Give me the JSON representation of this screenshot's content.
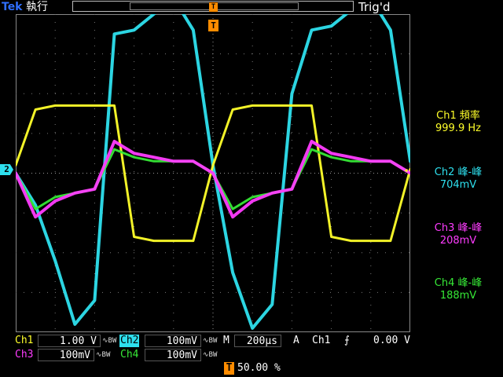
{
  "header": {
    "brand": "Tek",
    "acq_state": "執行",
    "trigger_status": "Trig'd"
  },
  "markers": {
    "ground_ch": "2",
    "trigger_pos_icon": "T",
    "trigger_level_icon": "◂"
  },
  "colors": {
    "ch1": "#ffff2a",
    "ch2": "#2ee0ee",
    "ch3": "#ff3cff",
    "ch4": "#36e836",
    "trigger": "#ff8c00"
  },
  "measurements": [
    {
      "label": "Ch1 頻率",
      "value": "999.9 Hz"
    },
    {
      "label": "Ch2 峰-峰",
      "value": "704mV"
    },
    {
      "label": "Ch3 峰-峰",
      "value": "208mV"
    },
    {
      "label": "Ch4 峰-峰",
      "value": "188mV"
    }
  ],
  "channels": {
    "ch1": {
      "name": "Ch1",
      "scale": "1.00 V",
      "bw": "∿BW"
    },
    "ch2": {
      "name": "Ch2",
      "scale": "100mV",
      "bw": "∿BW"
    },
    "ch3": {
      "name": "Ch3",
      "scale": "100mV",
      "bw": "∿BW"
    },
    "ch4": {
      "name": "Ch4",
      "scale": "100mV",
      "bw": "∿BW"
    }
  },
  "timebase": {
    "label": "M",
    "value": "200µs"
  },
  "trigger": {
    "mode": "A",
    "source": "Ch1",
    "slope": "⨍",
    "level": "0.00 V"
  },
  "horizontal_position": {
    "icon": "T",
    "value": "50.00 %"
  },
  "chart_data": {
    "type": "line",
    "xlabel": "",
    "ylabel": "",
    "grid": true,
    "x": [
      0,
      0.1,
      0.2,
      0.3,
      0.4,
      0.5,
      0.6,
      0.7,
      0.8,
      0.9,
      1.0,
      1.1,
      1.2,
      1.3,
      1.4,
      1.5,
      1.6,
      1.7,
      1.8,
      1.9,
      2.0
    ],
    "x_unit": "ms",
    "series": [
      {
        "name": "Ch1",
        "values": [
          0.2,
          1.6,
          1.7,
          1.7,
          1.7,
          1.7,
          -1.6,
          -1.7,
          -1.7,
          -1.7,
          0.2,
          1.6,
          1.7,
          1.7,
          1.7,
          1.7,
          -1.6,
          -1.7,
          -1.7,
          -1.7,
          0.1
        ]
      },
      {
        "name": "Ch2",
        "values": [
          0,
          -0.8,
          -2.2,
          -3.8,
          -3.2,
          3.5,
          3.6,
          4.0,
          4.4,
          3.6,
          0.2,
          -2.5,
          -3.9,
          -3.3,
          2.0,
          3.6,
          3.7,
          4.1,
          4.4,
          3.6,
          0.3
        ]
      },
      {
        "name": "Ch3",
        "values": [
          0,
          -1.1,
          -0.7,
          -0.5,
          -0.4,
          0.8,
          0.5,
          0.4,
          0.3,
          0.3,
          0,
          -1.1,
          -0.7,
          -0.5,
          -0.4,
          0.8,
          0.5,
          0.4,
          0.3,
          0.3,
          0
        ]
      },
      {
        "name": "Ch4",
        "values": [
          0,
          -0.9,
          -0.6,
          -0.5,
          -0.4,
          0.6,
          0.4,
          0.3,
          0.3,
          0.3,
          0,
          -0.9,
          -0.6,
          -0.5,
          -0.4,
          0.6,
          0.4,
          0.3,
          0.3,
          0.3,
          0
        ]
      }
    ],
    "xlim": [
      0,
      2.0
    ],
    "ylim": [
      -4,
      4
    ]
  }
}
